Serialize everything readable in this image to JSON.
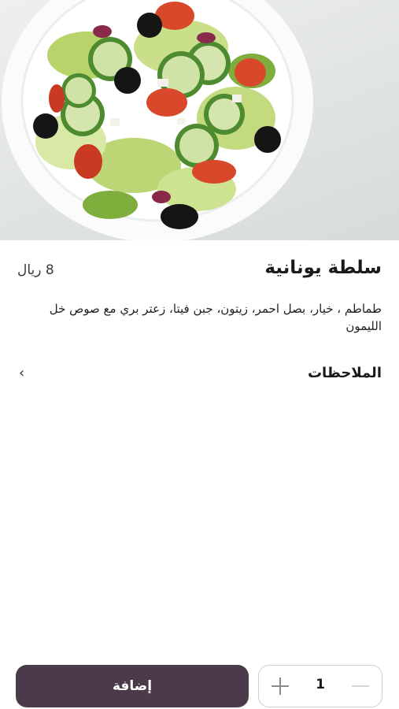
{
  "item": {
    "title": "سلطة يونانية",
    "price": "8 ريال",
    "description": "طماطم ، خيار، بصل احمر، زيتون، جبن فيتا، زعتر بري مع صوص خل الليمون",
    "image_icon": "salad-bowl-photo"
  },
  "notes": {
    "label": "الملاحظات",
    "chevron": "›"
  },
  "actions": {
    "add_label": "إضافة",
    "quantity": "1"
  },
  "colors": {
    "primary": "#4a3a4a",
    "stepper_border": "#cfcfcf"
  }
}
